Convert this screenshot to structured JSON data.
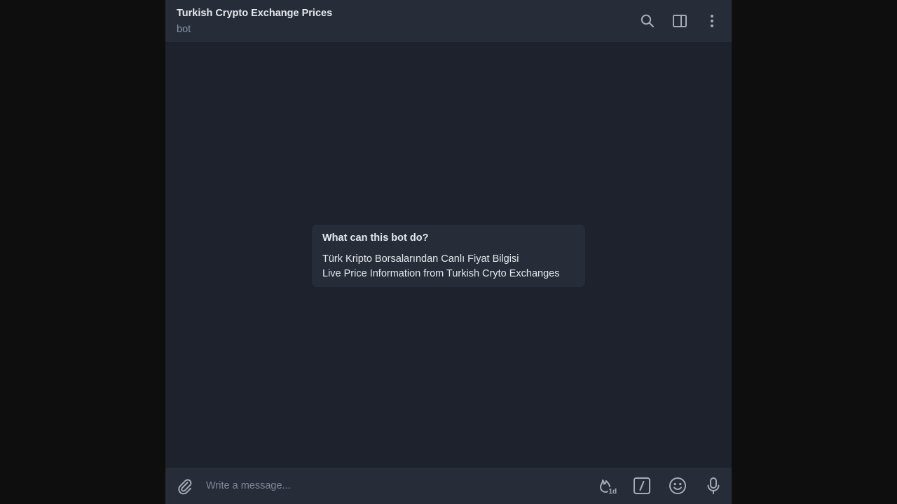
{
  "header": {
    "title": "Turkish Crypto Exchange Prices",
    "subtitle": "bot",
    "icons": [
      "search-icon",
      "sidebar-toggle-icon",
      "more-vert-icon"
    ]
  },
  "intro": {
    "heading": "What can this bot do?",
    "lines": [
      "Türk Kripto Borsalarından Canlı Fiyat Bilgisi",
      "Live Price Information from Turkish Cryto Exchanges"
    ]
  },
  "composer": {
    "placeholder": "Write a message...",
    "value": "",
    "icons": [
      "attach-icon",
      "autodelete-timer-icon",
      "bot-commands-icon",
      "emoji-icon",
      "microphone-icon"
    ],
    "timer_badge": "1d"
  },
  "colors": {
    "background": "#0e0e0e",
    "chat_bg": "#1d222c",
    "panel": "#262d38",
    "text": "#e6e9ee",
    "muted": "#8a94a3",
    "icon": "#a4acb7"
  }
}
